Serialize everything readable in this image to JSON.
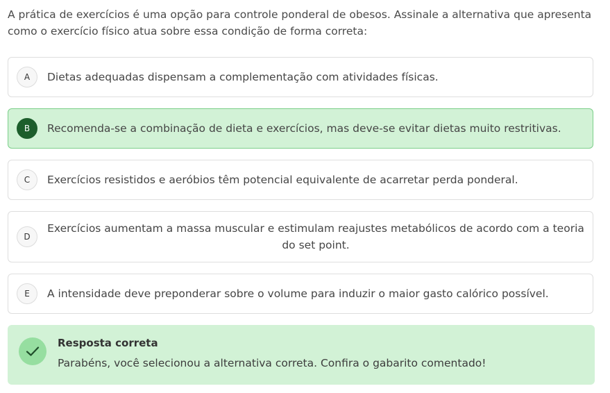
{
  "question": {
    "text": "A prática de exercícios é uma opção para controle ponderal de obesos. Assinale a alternativa que apresenta como o exercício físico atua sobre essa condição de forma correta:"
  },
  "options": [
    {
      "letter": "A",
      "text": "Dietas adequadas dispensam a complementação com atividades físicas.",
      "selected": false
    },
    {
      "letter": "B",
      "text": "Recomenda-se a combinação de dieta e exercícios, mas deve-se evitar dietas muito restritivas.",
      "selected": true
    },
    {
      "letter": "C",
      "text": "Exercícios resistidos e aeróbios têm potencial equivalente de acarretar perda ponderal.",
      "selected": false
    },
    {
      "letter": "D",
      "text": "Exercícios aumentam a massa muscular e estimulam reajustes metabólicos de acordo com a teoria do set point.",
      "selected": false
    },
    {
      "letter": "E",
      "text": "A intensidade deve preponderar sobre o volume para induzir o maior gasto calórico possível.",
      "selected": false
    }
  ],
  "feedback": {
    "title": "Resposta correta",
    "message": "Parabéns, você selecionou a alternativa correta. Confira o gabarito comentado!",
    "icon": "check-icon"
  },
  "colors": {
    "selected_bg": "#d2f2d6",
    "selected_border": "#7ccf8a",
    "selected_letter": "#1d5e2c",
    "check_circle": "#96dea0"
  }
}
